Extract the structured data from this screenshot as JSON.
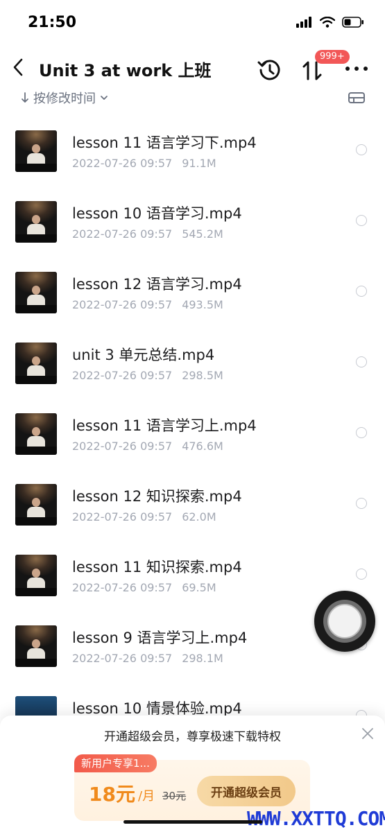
{
  "status_bar": {
    "time": "21:50"
  },
  "header": {
    "title": "Unit 3 at work 上班",
    "badge": "999+"
  },
  "sort": {
    "label": "按修改时间"
  },
  "files": [
    {
      "name": "lesson 11 语言学习下.mp4",
      "date": "2022-07-26 09:57",
      "size": "91.1M"
    },
    {
      "name": "lesson 10 语音学习.mp4",
      "date": "2022-07-26 09:57",
      "size": "545.2M"
    },
    {
      "name": "lesson 12 语言学习.mp4",
      "date": "2022-07-26 09:57",
      "size": "493.5M"
    },
    {
      "name": "unit 3 单元总结.mp4",
      "date": "2022-07-26 09:57",
      "size": "298.5M"
    },
    {
      "name": "lesson 11 语言学习上.mp4",
      "date": "2022-07-26 09:57",
      "size": "476.6M"
    },
    {
      "name": "lesson 12 知识探索.mp4",
      "date": "2022-07-26 09:57",
      "size": "62.0M"
    },
    {
      "name": "lesson 11 知识探索.mp4",
      "date": "2022-07-26 09:57",
      "size": "69.5M"
    },
    {
      "name": "lesson 9 语言学习上.mp4",
      "date": "2022-07-26 09:57",
      "size": "298.1M"
    },
    {
      "name": "lesson 10 情景体验.mp4",
      "date": "",
      "size": ""
    }
  ],
  "promo": {
    "title": "开通超级会员，尊享极速下载特权",
    "tag": "新用户专享1...",
    "price": "18元",
    "unit": "/月",
    "original_price": "30元",
    "button": "开通超级会员"
  },
  "watermark": "WWW.XXTTQ.COM",
  "colors": {
    "accent": "#f08a1c",
    "badge": "#f25757",
    "watermark": "#1f3bd6"
  }
}
